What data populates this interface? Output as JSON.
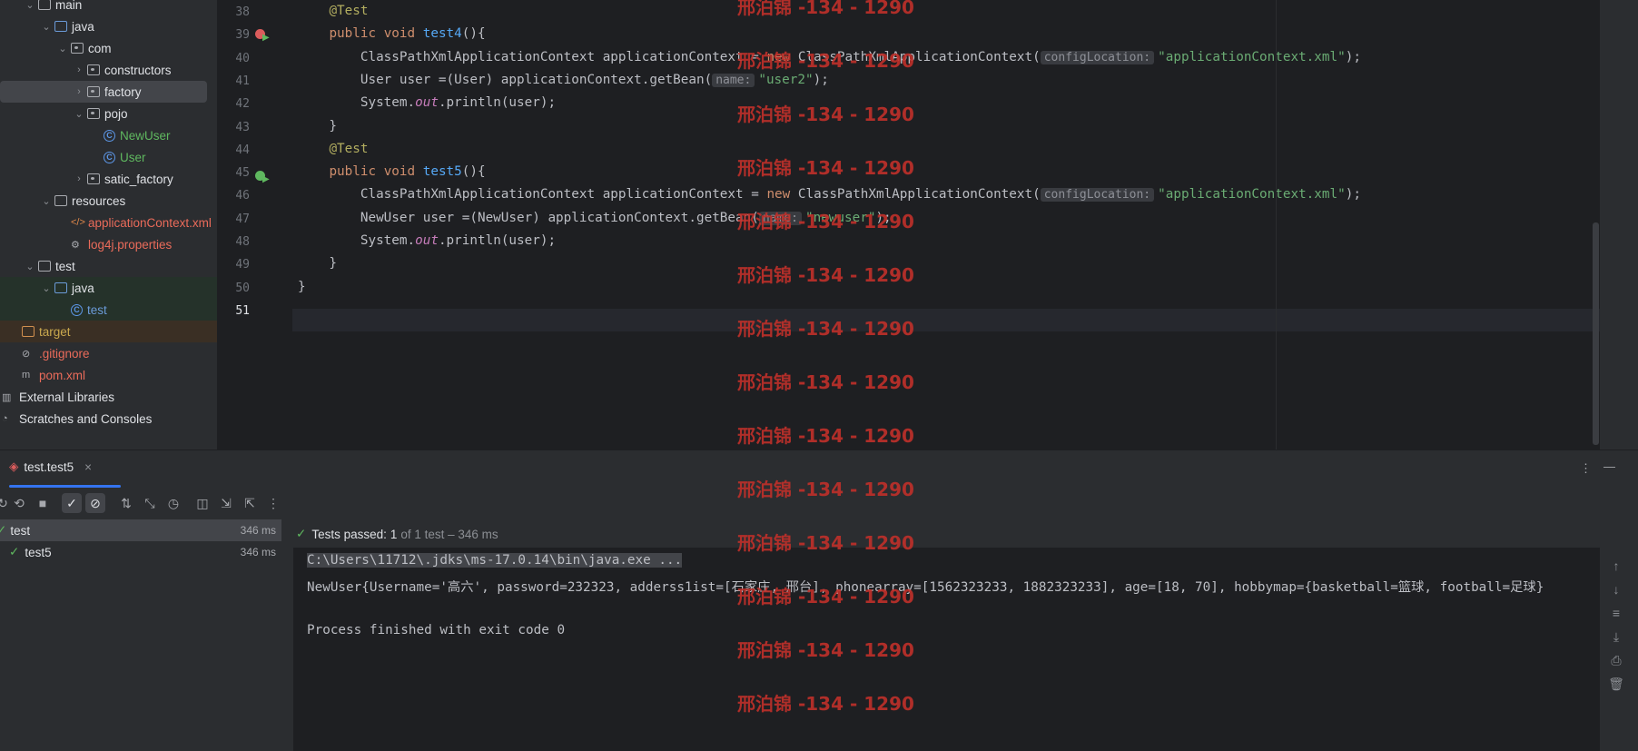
{
  "project_tree": {
    "items": [
      {
        "label": "main",
        "indent": 1,
        "chevron": "v",
        "icon": "folder"
      },
      {
        "label": "java",
        "indent": 2,
        "chevron": "v",
        "icon": "folder-blue"
      },
      {
        "label": "com",
        "indent": 3,
        "chevron": "v",
        "icon": "package"
      },
      {
        "label": "constructors",
        "indent": 4,
        "chevron": ">",
        "icon": "package"
      },
      {
        "label": "factory",
        "indent": 4,
        "chevron": ">",
        "icon": "package",
        "selected": true
      },
      {
        "label": "pojo",
        "indent": 4,
        "chevron": "v",
        "icon": "package"
      },
      {
        "label": "NewUser",
        "indent": 5,
        "chevron": "",
        "icon": "class",
        "color": "green"
      },
      {
        "label": "User",
        "indent": 5,
        "chevron": "",
        "icon": "class",
        "color": "green"
      },
      {
        "label": "satic_factory",
        "indent": 4,
        "chevron": ">",
        "icon": "package"
      },
      {
        "label": "resources",
        "indent": 2,
        "chevron": "v",
        "icon": "folder"
      },
      {
        "label": "applicationContext.xml",
        "indent": 3,
        "chevron": "",
        "icon": "xml",
        "color": "red"
      },
      {
        "label": "log4j.properties",
        "indent": 3,
        "chevron": "",
        "icon": "gear",
        "color": "red"
      },
      {
        "label": "test",
        "indent": 1,
        "chevron": "v",
        "icon": "folder"
      },
      {
        "label": "java",
        "indent": 2,
        "chevron": "v",
        "icon": "folder-green",
        "bg": "test"
      },
      {
        "label": "test",
        "indent": 3,
        "chevron": "",
        "icon": "class",
        "color": "blue",
        "bg": "test"
      },
      {
        "label": "target",
        "indent": 0,
        "chevron": "",
        "icon": "folder-orange",
        "color": "olive",
        "bg": "excl"
      },
      {
        "label": ".gitignore",
        "indent": 0,
        "chevron": "",
        "icon": "ignore",
        "color": "red"
      },
      {
        "label": "pom.xml",
        "indent": 0,
        "chevron": "",
        "icon": "maven",
        "color": "red"
      },
      {
        "label": "External Libraries",
        "indent": -1,
        "chevron": "",
        "icon": "lib"
      },
      {
        "label": "Scratches and Consoles",
        "indent": -1,
        "chevron": "",
        "icon": "scratch"
      }
    ]
  },
  "editor": {
    "line_numbers": [
      "38",
      "39",
      "40",
      "41",
      "42",
      "43",
      "44",
      "45",
      "46",
      "47",
      "48",
      "49",
      "50",
      "51"
    ],
    "lines": [
      [
        {
          "t": "    "
        },
        {
          "t": "@Test",
          "c": "ann"
        }
      ],
      [
        {
          "t": "    "
        },
        {
          "t": "public void ",
          "c": "kw"
        },
        {
          "t": "test4",
          "c": "fn"
        },
        {
          "t": "(){"
        }
      ],
      [
        {
          "t": "        ClassPathXmlApplicationContext applicationContext = "
        },
        {
          "t": "new ",
          "c": "kw"
        },
        {
          "t": "ClassPathXmlApplicationContext("
        },
        {
          "t": "configLocation:",
          "c": "hint"
        },
        {
          "t": "\"applicationContext.xml\"",
          "c": "str"
        },
        {
          "t": ");"
        }
      ],
      [
        {
          "t": "        User user =(User) applicationContext.getBean("
        },
        {
          "t": "name:",
          "c": "hint"
        },
        {
          "t": "\"user2\"",
          "c": "str"
        },
        {
          "t": ");"
        }
      ],
      [
        {
          "t": "        System."
        },
        {
          "t": "out",
          "c": "it"
        },
        {
          "t": ".println(user);"
        }
      ],
      [
        {
          "t": "    }"
        }
      ],
      [
        {
          "t": "    "
        },
        {
          "t": "@Test",
          "c": "ann"
        }
      ],
      [
        {
          "t": "    "
        },
        {
          "t": "public void ",
          "c": "kw"
        },
        {
          "t": "test5",
          "c": "fn"
        },
        {
          "t": "(){"
        }
      ],
      [
        {
          "t": "        ClassPathXmlApplicationContext applicationContext = "
        },
        {
          "t": "new ",
          "c": "kw"
        },
        {
          "t": "ClassPathXmlApplicationContext("
        },
        {
          "t": "configLocation:",
          "c": "hint"
        },
        {
          "t": "\"applicationContext.xml\"",
          "c": "str"
        },
        {
          "t": ");"
        }
      ],
      [
        {
          "t": "        NewUser user =(NewUser) applicationContext.getBean("
        },
        {
          "t": "name:",
          "c": "hint"
        },
        {
          "t": "\"newuser\"",
          "c": "str"
        },
        {
          "t": ");"
        }
      ],
      [
        {
          "t": "        System."
        },
        {
          "t": "out",
          "c": "it"
        },
        {
          "t": ".println(user);"
        }
      ],
      [
        {
          "t": "    }"
        }
      ],
      [
        {
          "t": "}"
        }
      ],
      [
        {
          "t": ""
        }
      ]
    ]
  },
  "run_panel": {
    "tab_label": "test.test5",
    "status": "Tests passed:",
    "passed_count": "1",
    "status_detail": "of 1 test – 346 ms",
    "tests": [
      {
        "name": "test",
        "duration": "346 ms"
      },
      {
        "name": "test5",
        "duration": "346 ms"
      }
    ],
    "console_lines": [
      "C:\\Users\\11712\\.jdks\\ms-17.0.14\\bin\\java.exe ...",
      "NewUser{Username='高六', password=232323, adderss1ist=[石家庄, 邢台], phonearray=[1562323233, 1882323233], age=[18, 70], hobbymap={basketball=篮球, football=足球}",
      "",
      "Process finished with exit code 0"
    ]
  },
  "watermark": "邢泊锦 -134 - 1290",
  "colors": {
    "accent": "#3574f0",
    "pass": "#5fb85f",
    "watermark": "#c0302a"
  }
}
